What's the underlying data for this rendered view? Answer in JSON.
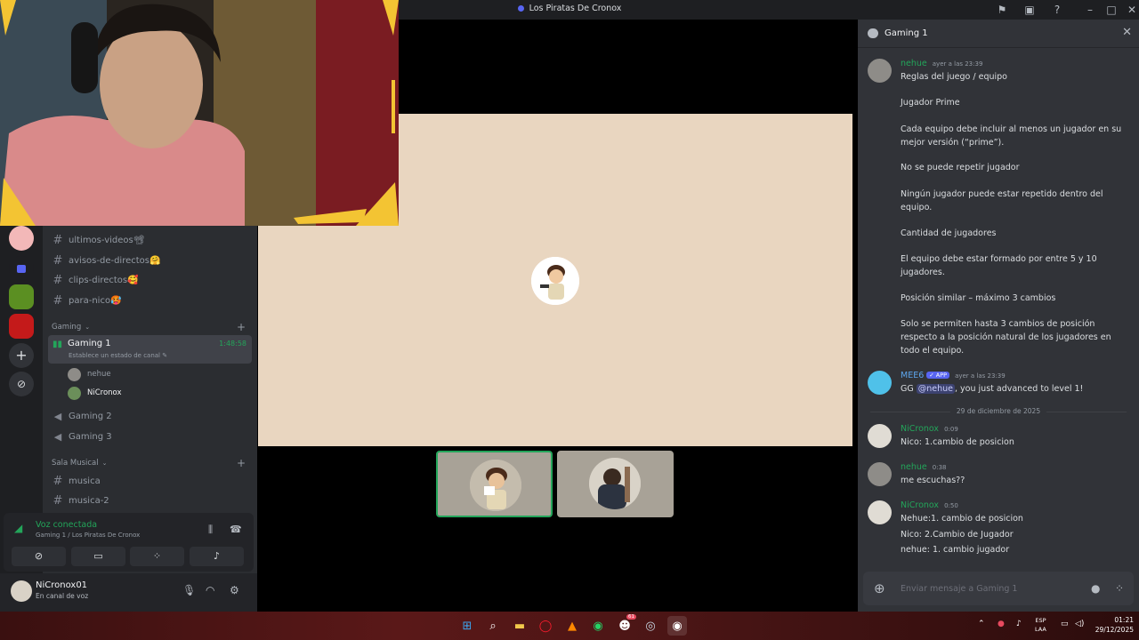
{
  "window": {
    "title": "Los Piratas De Cronox"
  },
  "channels": [
    {
      "name": "ultimos-videos📽"
    },
    {
      "name": "avisos-de-directos🤗"
    },
    {
      "name": "clips-directos🥰"
    },
    {
      "name": "para-nico🥵"
    }
  ],
  "category_gaming": "Gaming",
  "voice_active": {
    "name": "Gaming 1",
    "timer": "1:48:58",
    "status": "Establece un estado de canal",
    "members": [
      "nehue",
      "NiCronox"
    ]
  },
  "voice_channels": [
    "Gaming 2",
    "Gaming 3"
  ],
  "category_music": "Sala Musical",
  "music_channels": [
    "musica",
    "musica-2"
  ],
  "voice_panel": {
    "title": "Voz conectada",
    "subtitle": "Gaming 1 / Los Piratas De Cronox"
  },
  "user_panel": {
    "username": "NiCronox01",
    "status": "En canal de voz"
  },
  "chat": {
    "title": "Gaming 1",
    "messages": [
      {
        "author": "nehue",
        "time": "ayer a las 23:39",
        "lines": [
          "Reglas del juego / equipo",
          "Jugador Prime",
          "Cada equipo debe incluir al menos un jugador en su mejor versión (“prime”).",
          "No se puede repetir jugador",
          "Ningún jugador puede estar repetido dentro del equipo.",
          "Cantidad de jugadores",
          "El equipo debe estar formado por entre 5 y 10 jugadores.",
          "Posición similar – máximo 3 cambios",
          "Solo se permiten hasta 3 cambios de posición respecto a la posición natural de los jugadores en todo el equipo."
        ]
      },
      {
        "author": "MEE6",
        "badge": "✓ APP",
        "time": "ayer a las 23:39",
        "prefix": "GG ",
        "mention": "@nehue",
        "suffix": ", you just advanced to level 1!"
      },
      {
        "divider": "29 de diciembre de 2025"
      },
      {
        "author": "NiCronox",
        "time": "0:09",
        "lines": [
          "Nico: 1.cambio de posicion"
        ]
      },
      {
        "author": "nehue",
        "time": "0:38",
        "lines": [
          "me escuchas??"
        ]
      },
      {
        "author": "NiCronox",
        "time": "0:50",
        "lines": [
          "Nehue:1. cambio de posicion",
          "Nico: 2.Cambio de Jugador",
          "nehue: 1. cambio jugador"
        ]
      }
    ],
    "placeholder": "Enviar mensaje a Gaming 1"
  },
  "taskbar": {
    "lang": "ESP",
    "lang2": "LAA",
    "time": "01:21",
    "date": "29/12/2025",
    "badge_count": "61"
  },
  "icons": [
    "flag-icon",
    "inbox-icon",
    "help-icon",
    "minimize-icon",
    "maximize-icon",
    "close-icon",
    "hash-icon",
    "speaker-icon",
    "mic-icon",
    "headphones-icon",
    "gear-icon",
    "plus-icon",
    "gift-icon",
    "apps-icon",
    "windows-start-icon",
    "search-icon",
    "folder-icon",
    "opera-icon",
    "vlc-icon",
    "whatsapp-icon",
    "discord-icon",
    "steam-icon",
    "chrome-icon"
  ],
  "colors": {
    "accent": "#5865f2",
    "online": "#23a55a",
    "mention": "#5da5ec"
  }
}
